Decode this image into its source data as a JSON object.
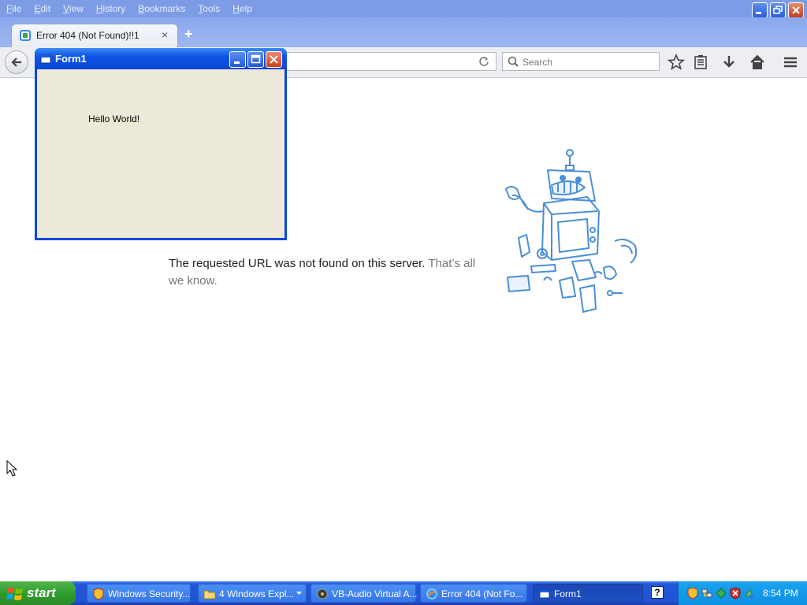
{
  "browser": {
    "menu": [
      "File",
      "Edit",
      "View",
      "History",
      "Bookmarks",
      "Tools",
      "Help"
    ],
    "tab_title": "Error 404 (Not Found)!!1",
    "tab_close": "×",
    "new_tab": "+",
    "search_placeholder": "Search"
  },
  "page": {
    "message": "The requested URL was not found on this server.",
    "message_extra": "That’s all we know."
  },
  "form1": {
    "title": "Form1",
    "label": "Hello World!"
  },
  "taskbar": {
    "start_label": "start",
    "tasks": [
      {
        "label": "Windows Security...",
        "icon": "shield-icon"
      },
      {
        "label": "4 Windows Expl...",
        "icon": "folder-icon"
      },
      {
        "label": "VB-Audio Virtual A...",
        "icon": "audio-icon"
      },
      {
        "label": "Error 404 (Not Fo...",
        "icon": "browser-icon"
      },
      {
        "label": "Form1",
        "icon": "form-icon"
      }
    ],
    "help_label": "?",
    "clock": "8:54 PM"
  },
  "colors": {
    "xp_blue": "#0a47d8",
    "xp_green": "#2e9a2b",
    "robot_blue": "#4a8fd6"
  }
}
